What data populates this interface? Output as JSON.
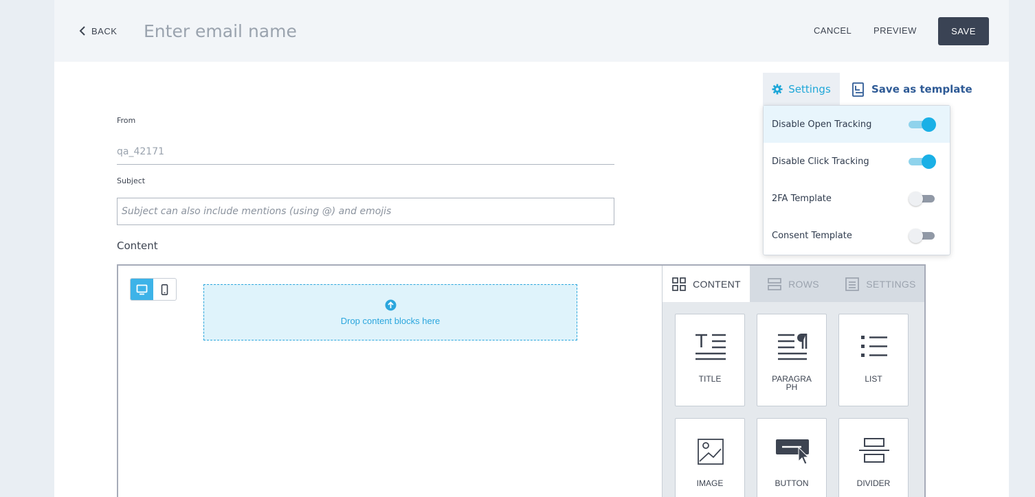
{
  "header": {
    "back_label": "BACK",
    "email_name_placeholder": "Enter email name",
    "cancel_label": "CANCEL",
    "preview_label": "PREVIEW",
    "save_label": "SAVE"
  },
  "toolbar": {
    "settings_label": "Settings",
    "save_template_label": "Save as template"
  },
  "settings_menu": {
    "items": [
      {
        "label": "Disable Open Tracking",
        "enabled": true,
        "highlighted": true
      },
      {
        "label": "Disable Click Tracking",
        "enabled": true,
        "highlighted": false
      },
      {
        "label": "2FA Template",
        "enabled": false,
        "highlighted": false
      },
      {
        "label": "Consent Template",
        "enabled": false,
        "highlighted": false
      }
    ]
  },
  "form": {
    "from_label": "From",
    "from_value": "qa_42171",
    "subject_label": "Subject",
    "subject_placeholder": "Subject can also include mentions (using @) and emojis",
    "content_label": "Content"
  },
  "editor": {
    "device_mode": "desktop",
    "dropzone_text": "Drop content blocks here",
    "tabs": [
      {
        "label": "CONTENT",
        "active": true
      },
      {
        "label": "ROWS",
        "active": false
      },
      {
        "label": "SETTINGS",
        "active": false
      }
    ],
    "blocks": [
      {
        "label": "TITLE",
        "icon": "title-icon"
      },
      {
        "label": "PARAGRA PH",
        "icon": "paragraph-icon"
      },
      {
        "label": "LIST",
        "icon": "list-icon"
      },
      {
        "label": "IMAGE",
        "icon": "image-icon"
      },
      {
        "label": "BUTTON",
        "icon": "button-icon"
      },
      {
        "label": "DIVIDER",
        "icon": "divider-icon"
      }
    ]
  },
  "colors": {
    "accent": "#1ab0e6",
    "primary_button": "#3a4354",
    "link": "#2f5b96"
  }
}
